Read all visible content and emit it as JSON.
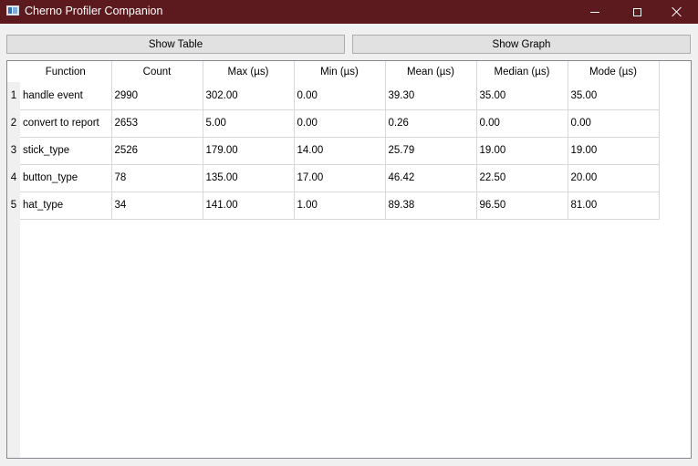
{
  "window": {
    "title": "Cherno Profiler Companion"
  },
  "toolbar": {
    "show_table_label": "Show Table",
    "show_graph_label": "Show Graph"
  },
  "table": {
    "headers": [
      "Function",
      "Count",
      "Max (µs)",
      "Min (µs)",
      "Mean (µs)",
      "Median (µs)",
      "Mode (µs)"
    ],
    "rows": [
      {
        "num": "1",
        "cells": [
          "handle event",
          "2990",
          "302.00",
          "0.00",
          "39.30",
          "35.00",
          "35.00"
        ]
      },
      {
        "num": "2",
        "cells": [
          "convert to report",
          "2653",
          "5.00",
          "0.00",
          "0.26",
          "0.00",
          "0.00"
        ]
      },
      {
        "num": "3",
        "cells": [
          "stick_type",
          "2526",
          "179.00",
          "14.00",
          "25.79",
          "19.00",
          "19.00"
        ]
      },
      {
        "num": "4",
        "cells": [
          "button_type",
          "78",
          "135.00",
          "17.00",
          "46.42",
          "22.50",
          "20.00"
        ]
      },
      {
        "num": "5",
        "cells": [
          "hat_type",
          "34",
          "141.00",
          "1.00",
          "89.38",
          "96.50",
          "81.00"
        ]
      }
    ]
  }
}
